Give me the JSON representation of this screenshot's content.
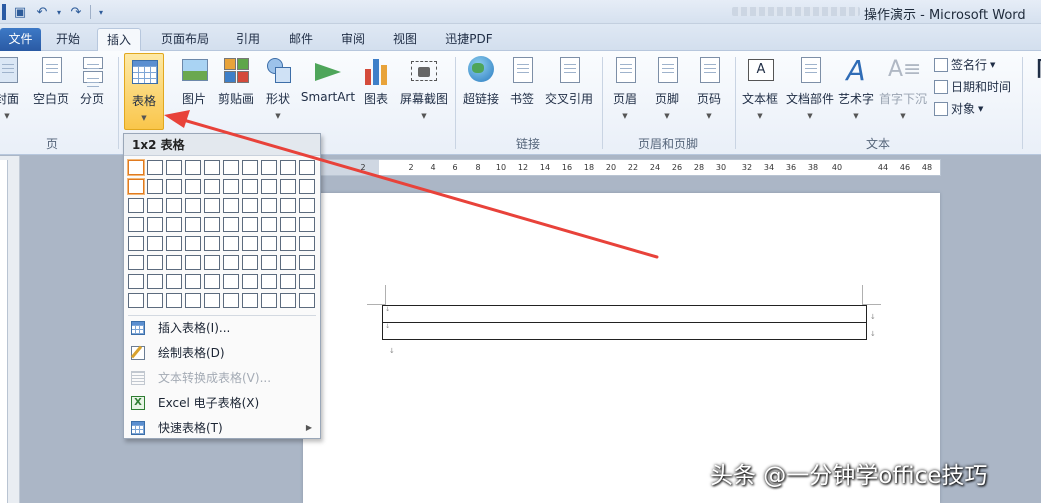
{
  "window": {
    "title": "操作演示 - Microsoft Word"
  },
  "tabs": [
    {
      "label": "文件"
    },
    {
      "label": "开始"
    },
    {
      "label": "插入"
    },
    {
      "label": "页面布局"
    },
    {
      "label": "引用"
    },
    {
      "label": "邮件"
    },
    {
      "label": "审阅"
    },
    {
      "label": "视图"
    },
    {
      "label": "迅捷PDF"
    }
  ],
  "active_tab": "插入",
  "ribbon": {
    "pages": {
      "cover": "封面",
      "blank": "空白页",
      "break": "分页",
      "group": "页"
    },
    "tables": {
      "table": "表格"
    },
    "illustrations": {
      "picture": "图片",
      "clipart": "剪贴画",
      "shapes": "形状",
      "smartart": "SmartArt",
      "chart": "图表",
      "screenshot": "屏幕截图"
    },
    "links": {
      "hyperlink": "超链接",
      "bookmark": "书签",
      "crossref": "交叉引用",
      "group": "链接"
    },
    "header_footer": {
      "header": "页眉",
      "footer": "页脚",
      "pagenum": "页码",
      "group": "页眉和页脚"
    },
    "text": {
      "textbox": "文本框",
      "quickparts": "文档部件",
      "wordart": "艺术字",
      "dropcap": "首字下沉",
      "signature": "签名行",
      "datetime": "日期和时间",
      "object": "对象",
      "group": "文本"
    }
  },
  "ruler": {
    "ticks": [
      "2",
      "2",
      "4",
      "6",
      "8",
      "10",
      "12",
      "14",
      "16",
      "18",
      "20",
      "22",
      "24",
      "26",
      "28",
      "30",
      "32",
      "34",
      "36",
      "38",
      "40",
      "44",
      "46",
      "48"
    ]
  },
  "table_menu": {
    "header": "1x2 表格",
    "grid_cols": 10,
    "grid_rows": 8,
    "selected_cols": 1,
    "selected_rows": 2,
    "items": [
      {
        "label": "插入表格(I)...",
        "icon": "insert-table-icon",
        "enabled": true
      },
      {
        "label": "绘制表格(D)",
        "icon": "draw-table-icon",
        "enabled": true
      },
      {
        "label": "文本转换成表格(V)...",
        "icon": "convert-text-icon",
        "enabled": false
      },
      {
        "label": "Excel 电子表格(X)",
        "icon": "excel-icon",
        "enabled": true
      },
      {
        "label": "快速表格(T)",
        "icon": "quick-table-icon",
        "enabled": true,
        "submenu": true
      }
    ]
  },
  "watermark": "头条 @一分钟学office技巧",
  "colors": {
    "highlight": "#f9c64b",
    "arrow": "#e8423a",
    "file_tab": "#2a5aa4"
  }
}
